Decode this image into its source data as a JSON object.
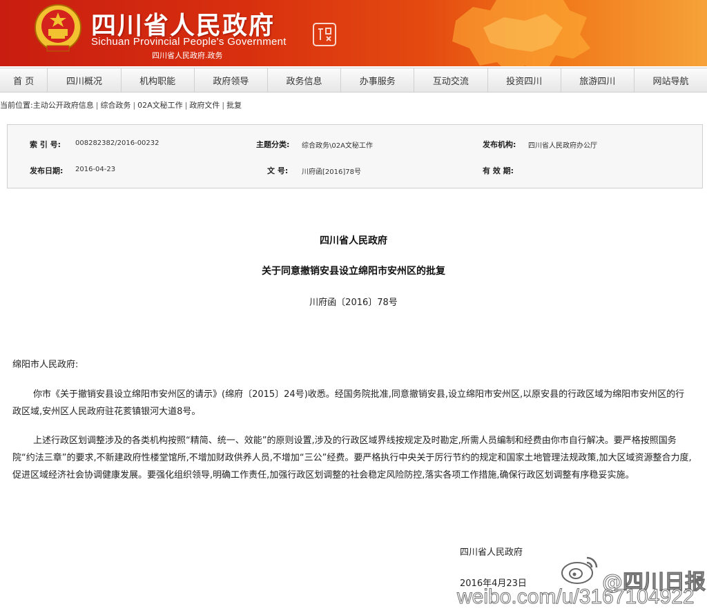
{
  "header": {
    "title": "四川省人民政府",
    "subtitle": "Sichuan Provincial People's Government",
    "tagline": "四川省人民政府.政务",
    "seal_text": "中国四川"
  },
  "nav": {
    "items": [
      "首 页",
      "四川概况",
      "机构职能",
      "政府领导",
      "政务信息",
      "办事服务",
      "互动交流",
      "投资四川",
      "旅游四川",
      "网站导航"
    ]
  },
  "breadcrumb": {
    "prefix": "当前位置:",
    "items": [
      "主动公开政府信息",
      "综合政务",
      "02A文秘工作",
      "政府文件",
      "批复"
    ],
    "separator": "|"
  },
  "info": {
    "index_label": "索 引 号:",
    "index_value": "008282382/2016-00232",
    "topic_label": "主题分类:",
    "topic_value": "综合政务\\02A文秘工作",
    "publisher_label": "发布机构:",
    "publisher_value": "四川省人民政府办公厅",
    "date_label": "发布日期:",
    "date_value": "2016-04-23",
    "docno_label": "文 号:",
    "docno_value": "川府函[2016]78号",
    "validity_label": "有 效 期:",
    "validity_value": ""
  },
  "document": {
    "issuer": "四川省人民政府",
    "title": "关于同意撤销安县设立绵阳市安州区的批复",
    "number": "川府函〔2016〕78号",
    "addressee": "绵阳市人民政府:",
    "paragraphs": [
      "你市《关于撤销安县设立绵阳市安州区的请示》(绵府〔2015〕24号)收悉。经国务院批准,同意撤销安县,设立绵阳市安州区,以原安县的行政区域为绵阳市安州区的行政区域,安州区人民政府驻花荄镇银河大道8号。",
      "上述行政区划调整涉及的各类机构按照“精简、统一、效能”的原则设置,涉及的行政区域界线按规定及时勘定,所需人员编制和经费由你市自行解决。要严格按照国务院“约法三章”的要求,不新建政府性楼堂馆所,不增加财政供养人员,不增加“三公”经费。要严格执行中央关于厉行节约的规定和国家土地管理法规政策,加大区域资源整合力度,促进区域经济社会协调健康发展。要强化组织领导,明确工作责任,加强行政区划调整的社会稳定风险防控,落实各项工作措施,确保行政区划调整有序稳妥实施。"
    ],
    "signer": "四川省人民政府",
    "date": "2016年4月23日"
  },
  "watermark": {
    "url": "weibo.com/u/3167104922",
    "handle": "@四川日报"
  },
  "colors": {
    "banner_red": "#c81d10",
    "banner_orange": "#f17a1a",
    "emblem_gold": "#f2c230"
  }
}
